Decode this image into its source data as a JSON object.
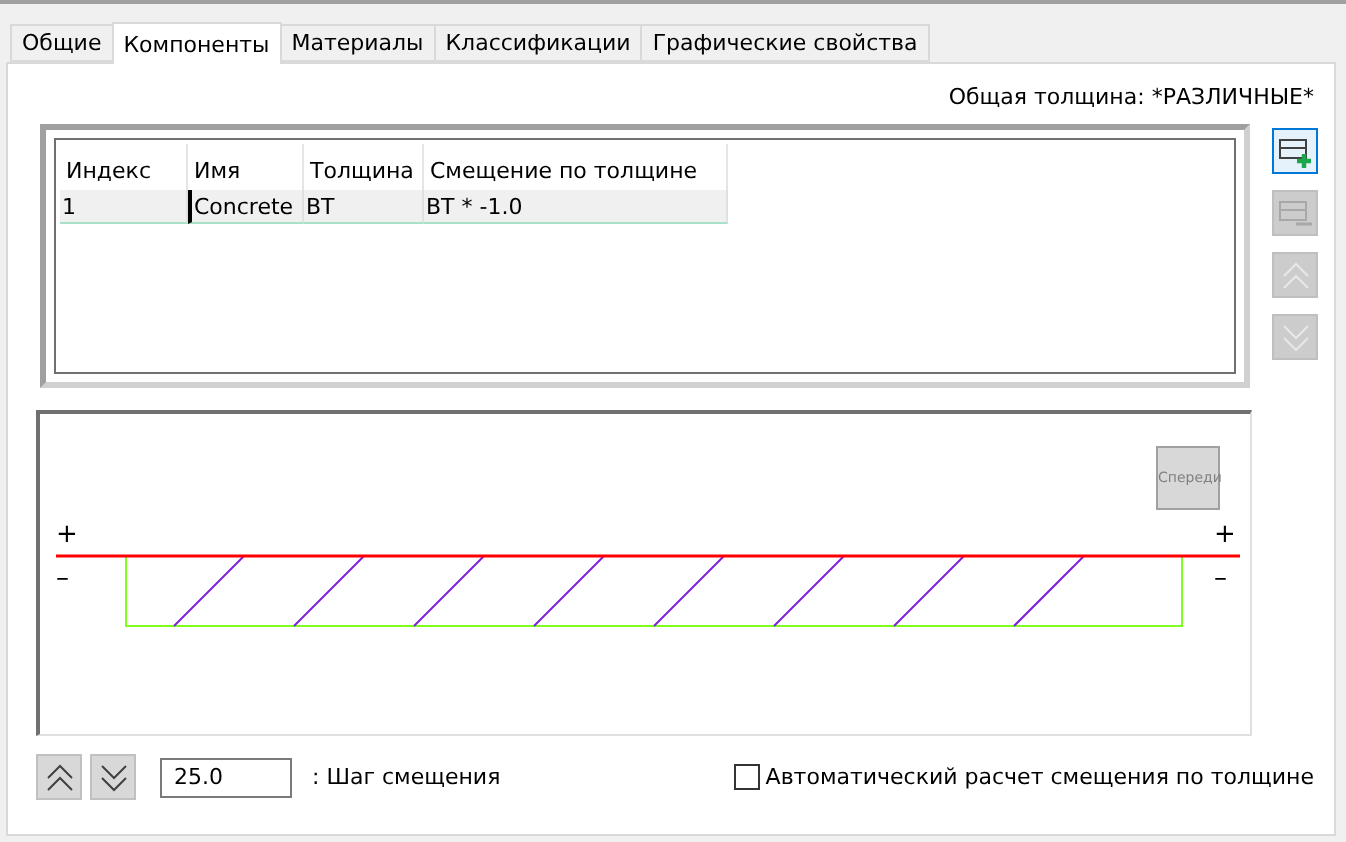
{
  "tabs": [
    {
      "label": "Общие",
      "selected": false
    },
    {
      "label": "Компоненты",
      "selected": true
    },
    {
      "label": "Материалы",
      "selected": false
    },
    {
      "label": "Классификации",
      "selected": false
    },
    {
      "label": "Графические свойства",
      "selected": false
    }
  ],
  "total_thickness": "Общая толщина: *РАЗЛИЧНЫЕ*",
  "table": {
    "columns": [
      "Индекс",
      "Имя",
      "Толщина",
      "Смещение по толщине"
    ],
    "rows": [
      {
        "cells": [
          "1",
          "Concrete",
          "BT",
          "BT * -1.0"
        ],
        "selected": true
      }
    ]
  },
  "side_buttons": [
    {
      "kind": "add",
      "disabled": false
    },
    {
      "kind": "remove",
      "disabled": true
    },
    {
      "kind": "up",
      "disabled": true
    },
    {
      "kind": "down",
      "disabled": true
    }
  ],
  "preview": {
    "view_button": "Спереди",
    "plus_left": "+",
    "plus_right": "+",
    "minus_left": "–",
    "minus_right": "–"
  },
  "step_field": {
    "value": "25.0",
    "label": ": Шаг смещения"
  },
  "auto_offset": {
    "label": "Автоматический расчет смещения по толщине",
    "checked": false
  }
}
